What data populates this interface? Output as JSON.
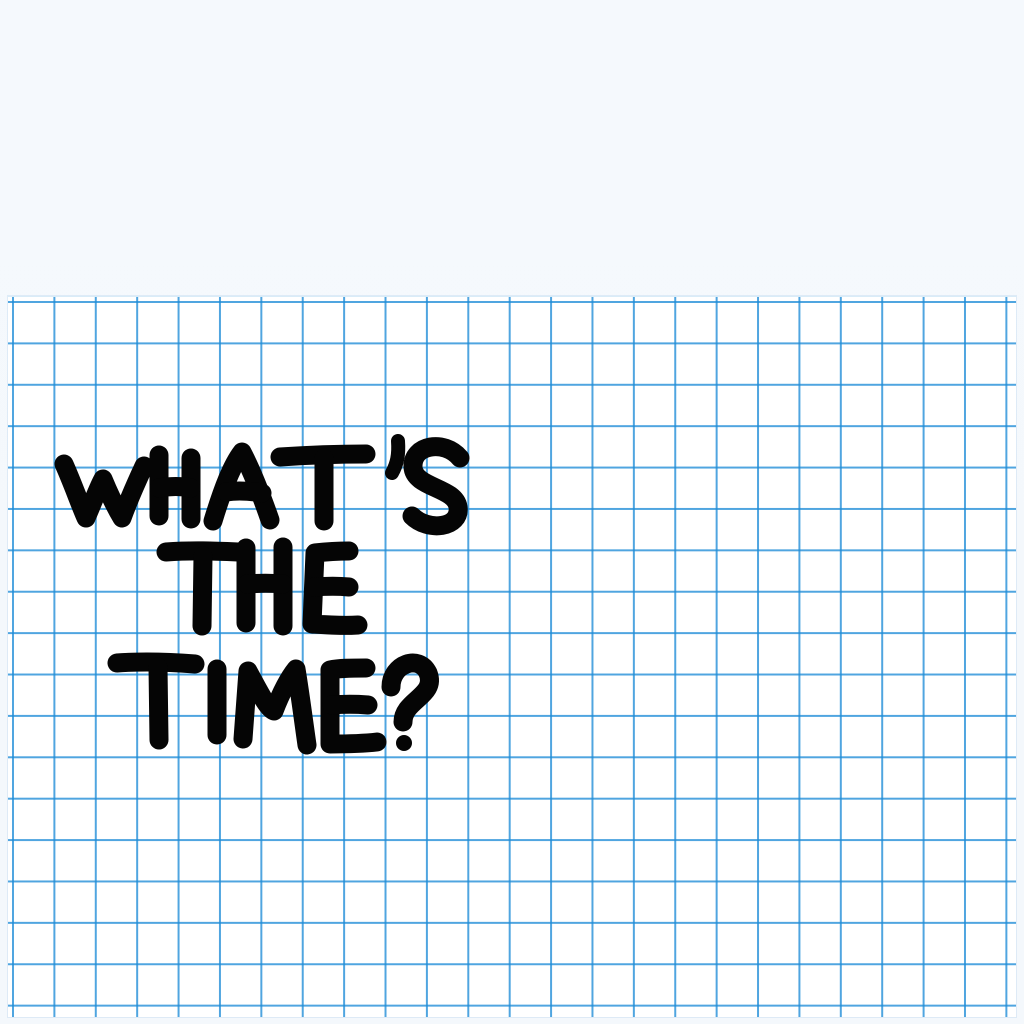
{
  "title": {
    "line_1": "WHAT'S",
    "line_2": "THE",
    "line_3": "TIME?"
  },
  "colors": {
    "background": "#f4f8fc",
    "paper": "#ffffff",
    "grid": "#1e8cd7",
    "ink": "#050505"
  }
}
